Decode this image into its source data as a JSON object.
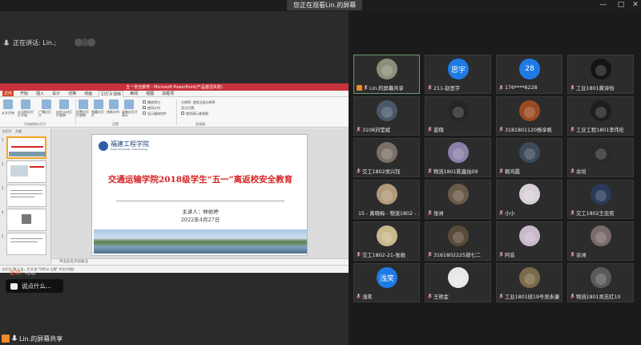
{
  "window": {
    "watch_banner": "您正在观看Lin.的屏幕",
    "controls": [
      "—",
      "□",
      "✕"
    ]
  },
  "share": {
    "speaking": "正在讲话: Lin.;",
    "share_tag": "Lin.的屏幕共享"
  },
  "ppt": {
    "title": "五一安全教育 - Microsoft PowerPoint(产品激活失败)",
    "tabs": [
      "文件",
      "开始",
      "插入",
      "设计",
      "切换",
      "动画",
      "幻灯片放映",
      "审阅",
      "视图",
      "加载项"
    ],
    "active_tab": "幻灯片放映",
    "ribbon_groups": [
      "开始放映幻灯片",
      "设置",
      "监视器"
    ],
    "ribbon_buttons": [
      "从头开始",
      "从当前幻灯片开始",
      "广播幻灯片",
      "自定义幻灯片放映",
      "设置幻灯片放映",
      "隐藏幻灯片",
      "排练计时",
      "录制幻灯片演示"
    ],
    "ribbon_checks": [
      "播放旁白",
      "使用计时",
      "显示媒体控件"
    ],
    "ribbon_resolution": "分辨率: 使用当前分辨率",
    "ribbon_monitor": "显示位置:",
    "ribbon_presenter": "使用演示者视图",
    "thumb_tabs": [
      "幻灯片",
      "大纲"
    ],
    "thumb_numbers": [
      "1",
      "2",
      "3",
      "4",
      "5"
    ],
    "notes_placeholder": "单击此处添加备注",
    "status": "幻灯片 第 1 张，共 8 张   \"Office 主题\"   中文(中国)"
  },
  "slide": {
    "school_name": "福建工程学院",
    "school_en": "Fujian University of Technology",
    "title": "交通运输学院2018级学生“五一”离返校安全教育",
    "presenter": "主讲人：林依婷",
    "date": "2022年4月27日"
  },
  "chat": {
    "sender": "张琪:",
    "message": "可以",
    "input_placeholder": "说点什么..."
  },
  "participants": [
    {
      "name": "Lin.的屏幕共享",
      "avatar": "photo",
      "color": "#8a8f7a",
      "host": true
    },
    {
      "name": "211-赵思宇",
      "avatar": "思宇",
      "color": "#1e7be6"
    },
    {
      "name": "176****6228",
      "avatar": "28",
      "color": "#1e7be6"
    },
    {
      "name": "工业1801黄诗怡",
      "avatar": "photo",
      "color": "#141414"
    },
    {
      "name": "3108刘莹斌",
      "avatar": "photo",
      "color": "#4a5868"
    },
    {
      "name": "蓝翔",
      "avatar": "photo",
      "color": "#252525"
    },
    {
      "name": "3181801120杨享帆",
      "avatar": "photo",
      "color": "#9a4a22"
    },
    {
      "name": "工业工程1801李伟伦",
      "avatar": "photo",
      "color": "#1e1e1e"
    },
    {
      "name": "交工1802吴兴钰",
      "avatar": "photo",
      "color": "#7a7066"
    },
    {
      "name": "物流1801陈鑫灿09",
      "avatar": "photo",
      "color": "#8a80a8"
    },
    {
      "name": "赖鸿霞",
      "avatar": "photo",
      "color": "#3c4a5a"
    },
    {
      "name": "余培",
      "avatar": "photo",
      "color": "#2a2a2a"
    },
    {
      "name": "15 - 黄晓梅 - 物流1802 - ...",
      "avatar": "photo",
      "color": "#b09a7a"
    },
    {
      "name": "张洲",
      "avatar": "photo",
      "color": "#6a5a4a"
    },
    {
      "name": "小小",
      "avatar": "photo",
      "color": "#d8d0d8"
    },
    {
      "name": "交工1802王忠奕",
      "avatar": "photo",
      "color": "#2a3a5a"
    },
    {
      "name": "交工1802-21-张驰",
      "avatar": "photo",
      "color": "#c8b88a"
    },
    {
      "name": "3161802225郭七二",
      "avatar": "photo",
      "color": "#5a4a3a"
    },
    {
      "name": "阿音",
      "avatar": "photo",
      "color": "#c8b8c8"
    },
    {
      "name": "余洲",
      "avatar": "photo",
      "color": "#7a6a6a"
    },
    {
      "name": "浅笑",
      "avatar": "浅笑",
      "color": "#1e7be6"
    },
    {
      "name": "王艳金",
      "avatar": "photo",
      "color": "#e8e8e8"
    },
    {
      "name": "工业1801班19号吴永康",
      "avatar": "photo",
      "color": "#7a6a4a"
    },
    {
      "name": "物流1801吴志红10",
      "avatar": "photo",
      "color": "#5a5a5a"
    }
  ]
}
